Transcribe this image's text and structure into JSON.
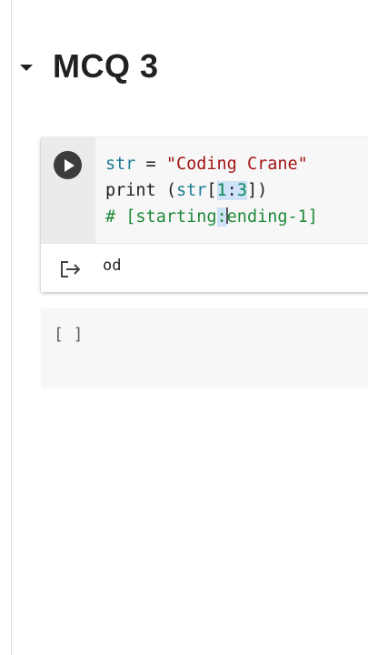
{
  "section": {
    "title": "MCQ 3"
  },
  "code_cell": {
    "line1": {
      "var": "str",
      "op": " = ",
      "string": "\"Coding Crane\""
    },
    "line2": {
      "fn": "print (",
      "arg": "str",
      "open": "[",
      "num1": "1",
      "colon": ":",
      "num2": "3",
      "close": "])"
    },
    "line3": {
      "comment_before": "# [starting",
      "comment_sel": ":",
      "comment_after": "ending-1]"
    },
    "output": "od"
  },
  "empty_cell": {
    "prompt": "[ ]"
  },
  "colors": {
    "variable": "#1d7e93",
    "string": "#a31515",
    "number": "#098658",
    "comment": "#1e8a3a"
  }
}
